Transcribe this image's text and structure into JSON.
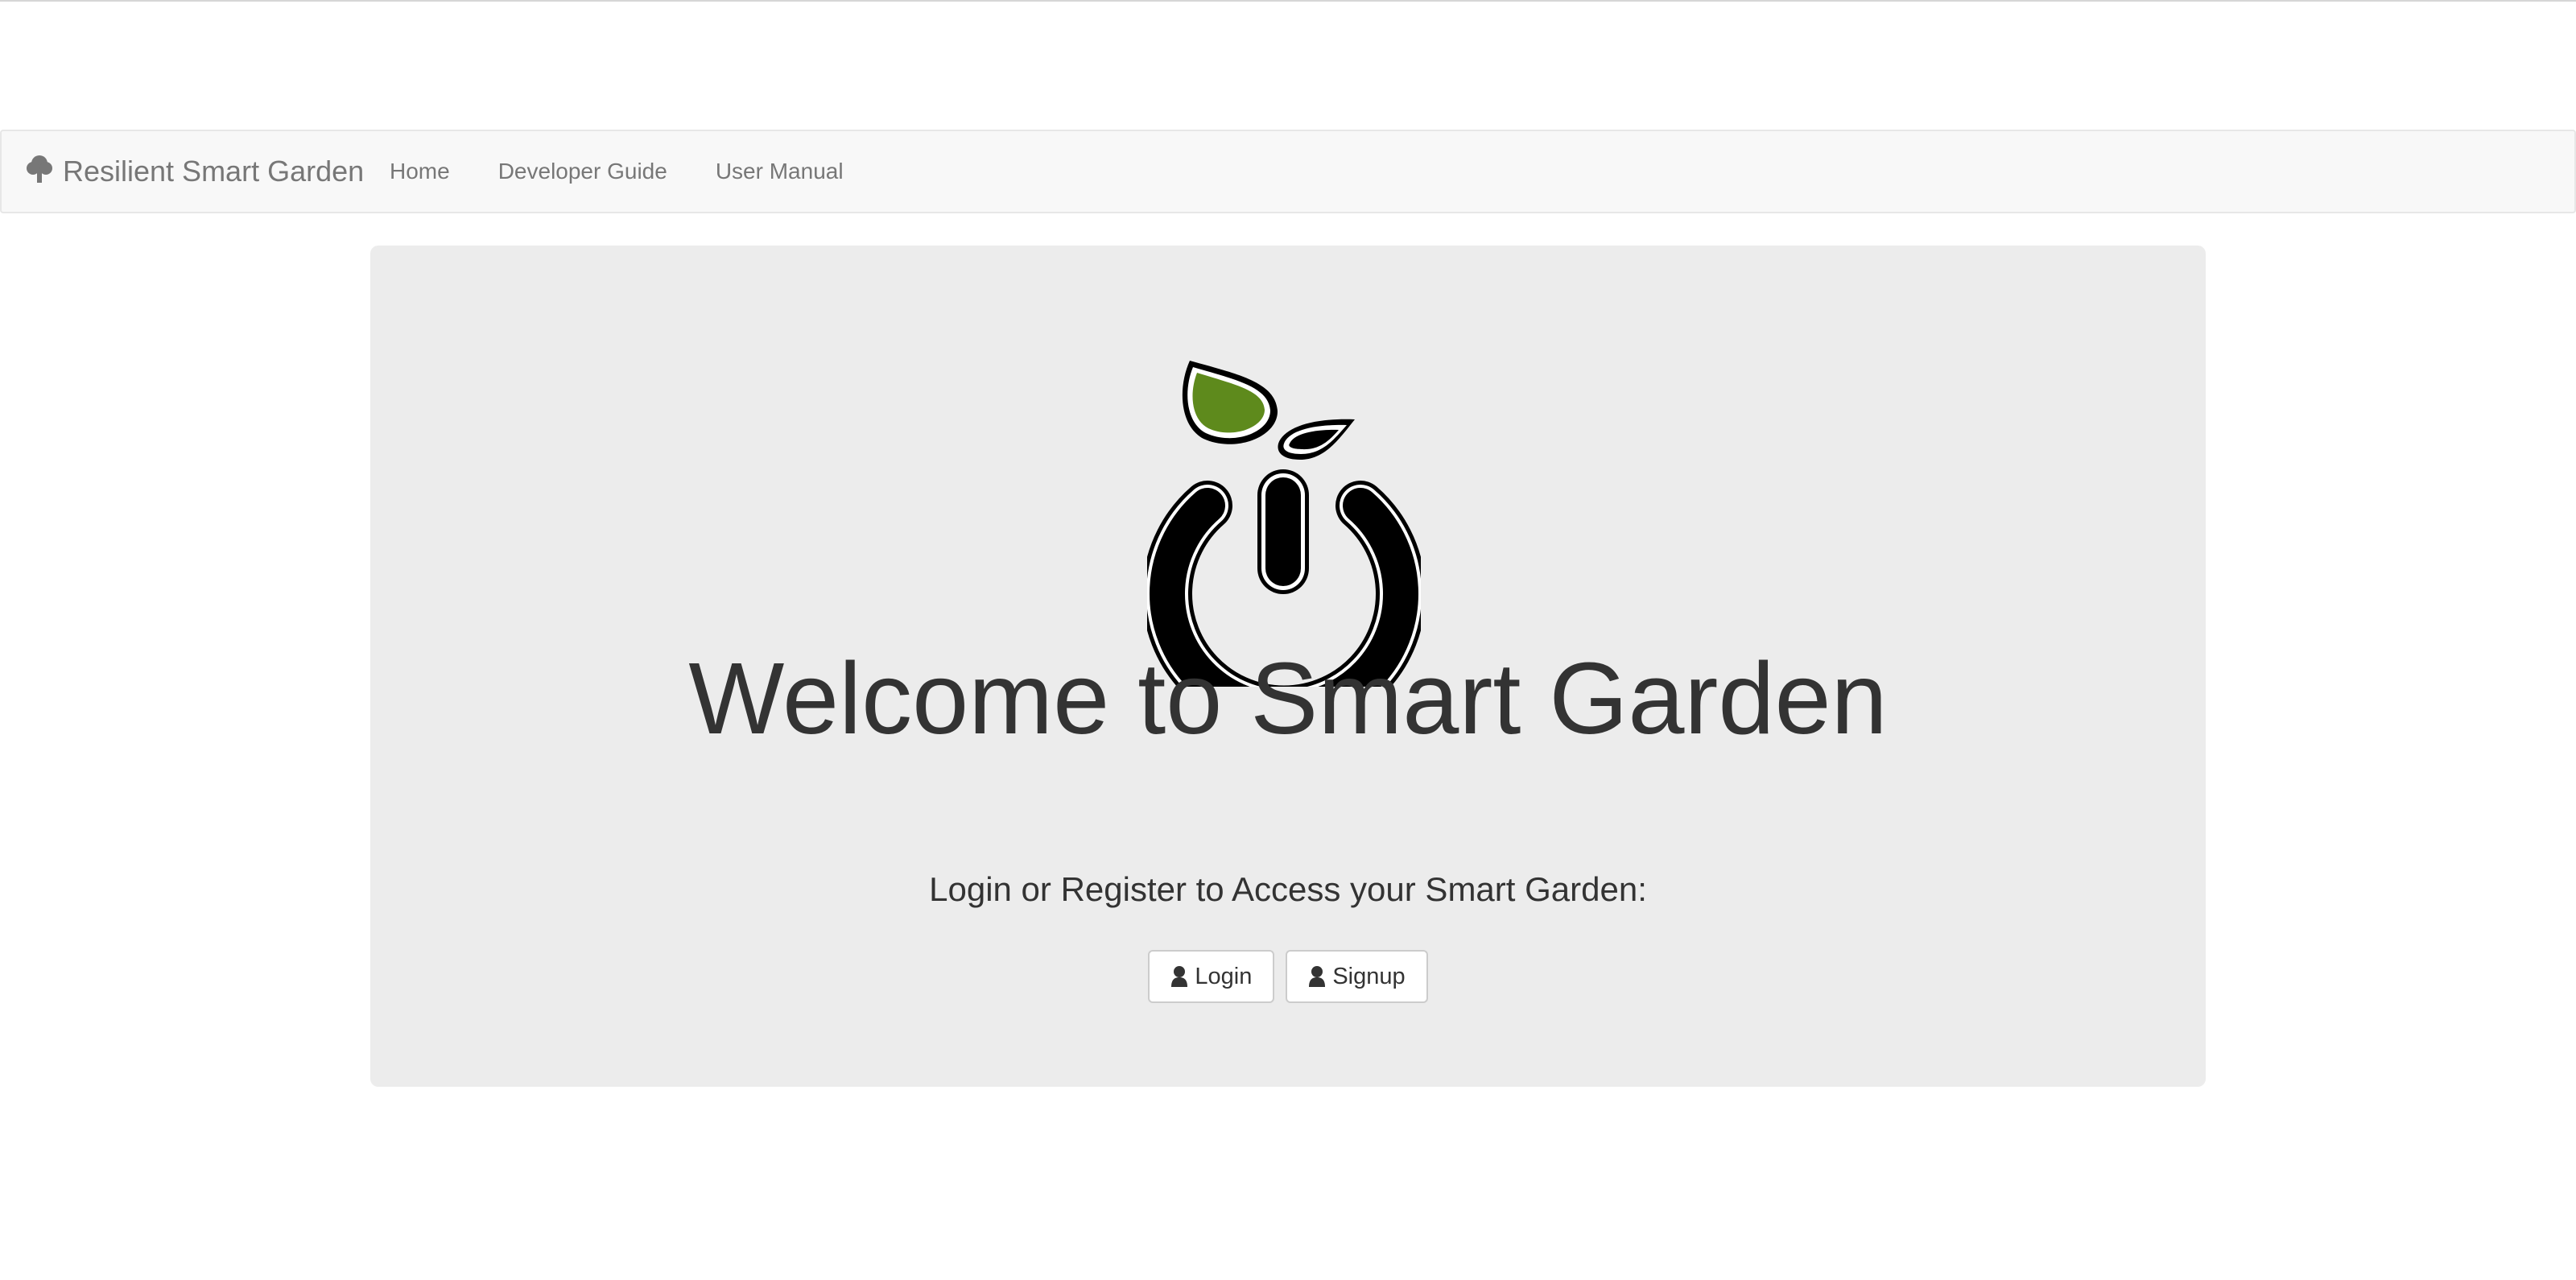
{
  "navbar": {
    "brand_icon": "tree-icon",
    "brand_label": "Resilient Smart Garden",
    "links": [
      {
        "label": "Home"
      },
      {
        "label": "Developer Guide"
      },
      {
        "label": "User Manual"
      }
    ]
  },
  "hero": {
    "logo_icon": "power-sprout-logo",
    "title": "Welcome to Smart Garden",
    "prompt": "Login or Register to Access your Smart Garden:",
    "buttons": {
      "login_label": "Login",
      "signup_label": "Signup",
      "icon": "user-icon"
    }
  },
  "colors": {
    "leaf_green": "#5e8a1c",
    "navbar_bg": "#f8f8f8",
    "jumbotron_bg": "#ececec",
    "text_dark": "#333333",
    "text_muted": "#777777"
  }
}
